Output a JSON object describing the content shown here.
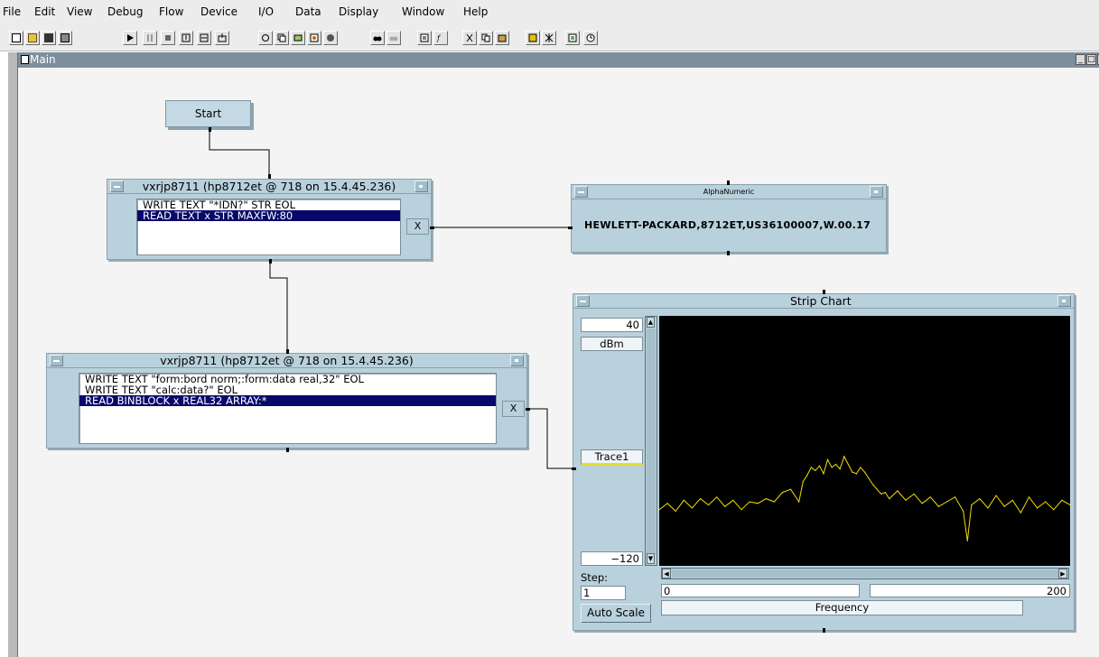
{
  "menu": [
    "File",
    "Edit",
    "View",
    "Debug",
    "Flow",
    "Device",
    "I/O",
    "Data",
    "Display",
    "Window",
    "Help"
  ],
  "toolbar_icons": [
    "new-icon",
    "open-icon",
    "save-icon",
    "print-icon",
    "run-icon",
    "pause-icon",
    "stop-icon",
    "step-into-icon",
    "step-over-icon",
    "step-out-icon",
    "hand-icon",
    "clone-icon",
    "detail-icon",
    "properties-icon",
    "probe-icon",
    "find-icon",
    "find-replace-icon",
    "object-properties-icon",
    "function-icon",
    "cut-icon",
    "copy-icon",
    "paste-icon",
    "panel-icon",
    "settings-icon",
    "panel-view-icon",
    "timer-icon"
  ],
  "main_window": {
    "title": "Main",
    "minimize": "_",
    "maximize": "□",
    "close": "x"
  },
  "start_button": {
    "label": "Start"
  },
  "io_object_1": {
    "title": "vxrjp8711 (hp8712et @ 718 on 15.4.45.236)",
    "lines": [
      {
        "text": "WRITE TEXT \"*IDN?\" STR EOL",
        "selected": false
      },
      {
        "text": "READ TEXT x STR MAXFW:80",
        "selected": true
      }
    ],
    "output_pin": "X"
  },
  "io_object_2": {
    "title": "vxrjp8711 (hp8712et @ 718 on 15.4.45.236)",
    "lines": [
      {
        "text": "WRITE TEXT \"form:bord norm;:form:data real,32\" EOL",
        "selected": false
      },
      {
        "text": "WRITE TEXT \"calc:data?\" EOL",
        "selected": false
      },
      {
        "text": "READ BINBLOCK x REAL32 ARRAY:*",
        "selected": true
      }
    ],
    "output_pin": "X"
  },
  "alphanumeric": {
    "title": "AlphaNumeric",
    "value": "HEWLETT-PACKARD,8712ET,US36100007,W.00.17"
  },
  "strip_chart": {
    "title": "Strip Chart",
    "y_max": "40",
    "y_unit": "dBm",
    "trace_label": "Trace1",
    "y_min": "−120",
    "step_label": "Step:",
    "step_value": "1",
    "auto_scale": "Auto Scale",
    "x_min": "0",
    "x_max": "200",
    "x_label": "Frequency"
  },
  "colors": {
    "trace": "#f0e000",
    "selection": "#08086b",
    "object_bg": "#b9d1dc"
  },
  "chart_data": {
    "type": "line",
    "title": "Strip Chart",
    "xlabel": "Frequency",
    "ylabel": "dBm",
    "xlim": [
      0,
      200
    ],
    "ylim": [
      -120,
      40
    ],
    "series": [
      {
        "name": "Trace1",
        "x": [
          0,
          4,
          8,
          12,
          16,
          20,
          24,
          28,
          32,
          36,
          40,
          44,
          48,
          52,
          56,
          60,
          64,
          68,
          70,
          72,
          74,
          76,
          78,
          80,
          82,
          84,
          86,
          88,
          90,
          92,
          94,
          96,
          98,
          100,
          102,
          104,
          106,
          108,
          110,
          112,
          116,
          120,
          124,
          128,
          132,
          136,
          140,
          144,
          148,
          150,
          152,
          156,
          160,
          164,
          168,
          172,
          176,
          180,
          184,
          188,
          192,
          196,
          200
        ],
        "y": [
          -84,
          -80,
          -85,
          -78,
          -83,
          -77,
          -81,
          -76,
          -82,
          -78,
          -84,
          -79,
          -80,
          -77,
          -79,
          -73,
          -71,
          -79,
          -66,
          -62,
          -57,
          -59,
          -56,
          -61,
          -52,
          -57,
          -55,
          -58,
          -50,
          -55,
          -60,
          -61,
          -57,
          -60,
          -64,
          -68,
          -71,
          -74,
          -73,
          -77,
          -72,
          -78,
          -74,
          -80,
          -76,
          -82,
          -79,
          -76,
          -85,
          -104,
          -81,
          -77,
          -83,
          -75,
          -82,
          -78,
          -86,
          -76,
          -83,
          -79,
          -84,
          -78,
          -81
        ]
      }
    ]
  }
}
